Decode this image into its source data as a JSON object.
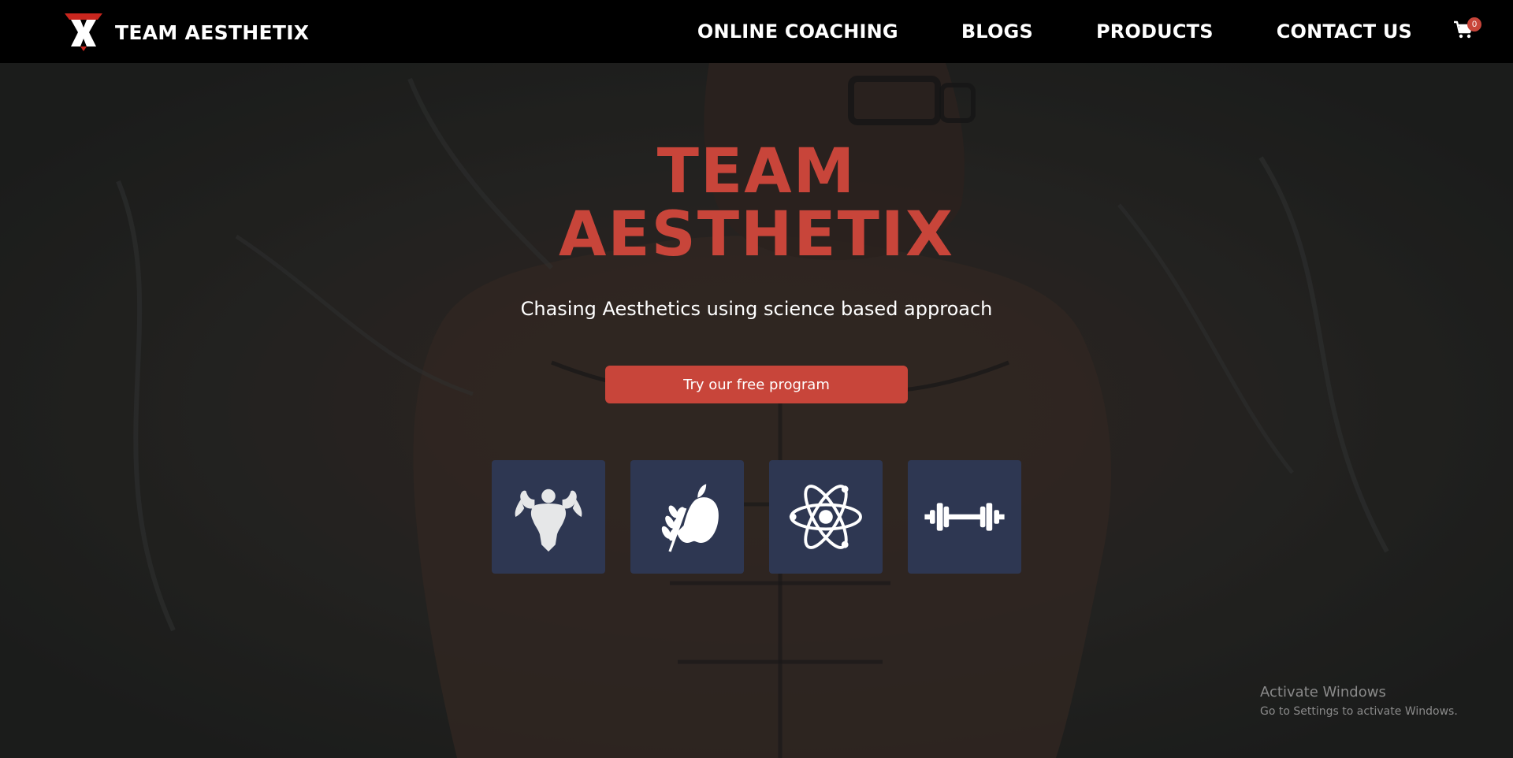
{
  "navbar": {
    "brand_name": "TEAM AESTHETIX",
    "links": [
      {
        "label": "ONLINE COACHING"
      },
      {
        "label": "BLOGS"
      },
      {
        "label": "PRODUCTS"
      },
      {
        "label": "CONTACT US"
      }
    ],
    "cart": {
      "icon": "shopping-cart-icon",
      "count": "0"
    }
  },
  "hero": {
    "title_line1": "TEAM",
    "title_line2": "AESTHETIX",
    "subtitle": "Chasing Aesthetics using science based approach",
    "cta_label": "Try our free program",
    "feature_icons": [
      "bodybuilder-icon",
      "apple-wheat-icon",
      "atom-icon",
      "barbell-icon"
    ]
  },
  "watermark": {
    "title": "Activate Windows",
    "subtitle": "Go to Settings to activate Windows."
  },
  "colors": {
    "navbar_bg": "#000000",
    "accent": "#c8453a",
    "tile_bg": "#2e3752",
    "hero_overlay": "#1e201e"
  }
}
